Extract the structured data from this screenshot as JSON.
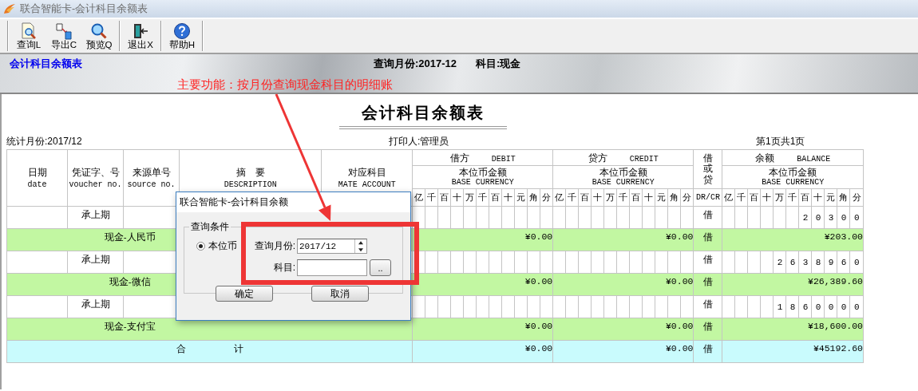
{
  "window": {
    "title": "联合智能卡-会计科目余额表"
  },
  "toolbar": [
    {
      "label": "查询L",
      "kind": "query",
      "group_end": false
    },
    {
      "label": "导出C",
      "kind": "export",
      "group_end": false
    },
    {
      "label": "预览Q",
      "kind": "preview",
      "group_end": true
    },
    {
      "label": "退出X",
      "kind": "exit",
      "group_end": true
    },
    {
      "label": "帮助H",
      "kind": "help",
      "group_end": true
    }
  ],
  "banner": {
    "title": "会计科目余额表",
    "query_month": "查询月份:2017-12",
    "subject": "科目:现金"
  },
  "annotation": {
    "text": "主要功能：按月份查询现金科目的明细账"
  },
  "report": {
    "title": "会计科目余额表",
    "period": "统计月份:2017/12",
    "printer": "打印人:管理员",
    "page": "第1页共1页",
    "header": {
      "date": {
        "cn": "日期",
        "en": "date"
      },
      "voucher": {
        "cn": "凭证字、号",
        "en": "voucher no."
      },
      "source": {
        "cn": "来源单号",
        "en": "source no."
      },
      "description": {
        "cn": "摘　要",
        "en": "DESCRIPTION"
      },
      "mate_account": {
        "cn": "对应科目",
        "en": "MATE ACCOUNT"
      },
      "amounts": [
        {
          "cn": "借方",
          "en": "DEBIT",
          "sub_cn": "本位币金额",
          "sub_en": "BASE CURRENCY",
          "digits": [
            "亿",
            "千",
            "百",
            "十",
            "万",
            "千",
            "百",
            "十",
            "元",
            "角",
            "分"
          ]
        },
        {
          "cn": "贷方",
          "en": "CREDIT",
          "sub_cn": "本位币金额",
          "sub_en": "BASE CURRENCY",
          "digits": [
            "亿",
            "千",
            "百",
            "十",
            "万",
            "千",
            "百",
            "十",
            "元",
            "角",
            "分"
          ]
        }
      ],
      "dr_cr": {
        "cn": "借或贷",
        "en": "DR/CR"
      },
      "balance": {
        "cn": "余额",
        "en": "BALANCE",
        "sub_cn": "本位币金额",
        "sub_en": "BASE CURRENCY",
        "digits": [
          "亿",
          "千",
          "百",
          "十",
          "万",
          "千",
          "百",
          "十",
          "元",
          "角",
          "分"
        ]
      }
    },
    "rows": [
      {
        "kind": "detail",
        "voucher": "承上期",
        "dr_cr": "借",
        "balance_digits": [
          "2",
          "0",
          "3",
          "0",
          "0"
        ]
      },
      {
        "kind": "subtotal",
        "account": "现金-人民币",
        "debit": "¥0.00",
        "credit": "¥0.00",
        "dr_cr": "借",
        "balance": "¥203.00"
      },
      {
        "kind": "detail",
        "voucher": "承上期",
        "dr_cr": "借",
        "balance_digits": [
          "2",
          "6",
          "3",
          "8",
          "9",
          "6",
          "0"
        ]
      },
      {
        "kind": "subtotal",
        "account": "现金-微信",
        "debit": "¥0.00",
        "credit": "¥0.00",
        "dr_cr": "借",
        "balance": "¥26,389.60"
      },
      {
        "kind": "detail",
        "voucher": "承上期",
        "dr_cr": "借",
        "balance_digits": [
          "1",
          "8",
          "6",
          "0",
          "0",
          "0",
          "0"
        ]
      },
      {
        "kind": "subtotal",
        "account": "现金-支付宝",
        "debit": "¥0.00",
        "credit": "¥0.00",
        "dr_cr": "借",
        "balance": "¥18,600.00"
      },
      {
        "kind": "total",
        "account": "合　　　　　计",
        "debit": "¥0.00",
        "credit": "¥0.00",
        "dr_cr": "借",
        "balance": "¥45192.60"
      }
    ]
  },
  "dialog": {
    "title": "联合智能卡-会计科目余额",
    "group": "查询条件",
    "currency": {
      "label": "本位币",
      "selected": true
    },
    "month_label": "查询月份:",
    "month_value": "2017/12",
    "subject_label": "科目:",
    "browse": "..",
    "ok": "确定",
    "cancel": "取消"
  }
}
